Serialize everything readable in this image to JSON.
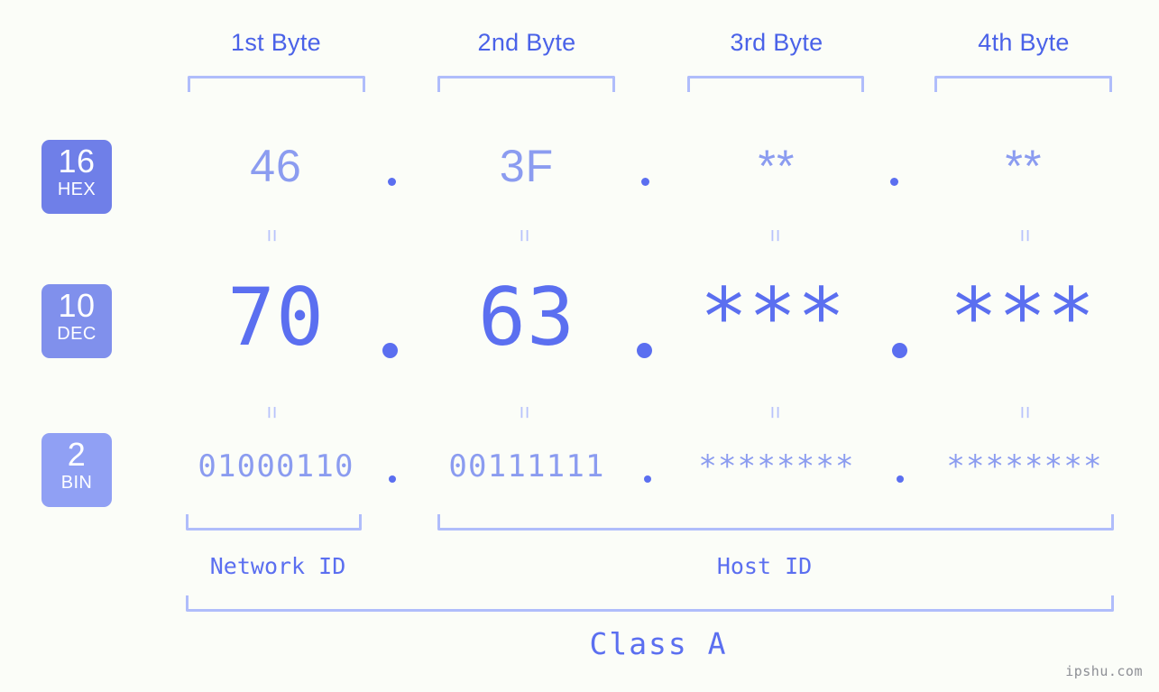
{
  "header": {
    "byte_labels": [
      "1st Byte",
      "2nd Byte",
      "3rd Byte",
      "4th Byte"
    ]
  },
  "bases": [
    {
      "num": "16",
      "name": "HEX",
      "color": "#6f7fe8"
    },
    {
      "num": "10",
      "name": "DEC",
      "color": "#8090ec"
    },
    {
      "num": "2",
      "name": "BIN",
      "color": "#90a0f4"
    }
  ],
  "rows": {
    "hex": {
      "values": [
        "46",
        "3F",
        "**",
        "**"
      ],
      "separators": [
        ".",
        ".",
        "."
      ]
    },
    "dec": {
      "values": [
        "70",
        "63",
        "***",
        "***"
      ],
      "separators": [
        ".",
        ".",
        "."
      ]
    },
    "bin": {
      "values": [
        "01000110",
        "00111111",
        "********",
        "********"
      ],
      "separators": [
        ".",
        ".",
        "."
      ]
    }
  },
  "equals": {
    "symbol": "=",
    "row1": [
      "=",
      "=",
      "=",
      "="
    ],
    "row2": [
      "=",
      "=",
      "=",
      "="
    ]
  },
  "segments": {
    "network_id": "Network ID",
    "host_id": "Host ID",
    "class": "Class A"
  },
  "watermark": "ipshu.com",
  "colors": {
    "background": "#fbfdf8",
    "bracket": "#b0bdfb",
    "header_text": "#4a62e8",
    "hex_text": "#8b9cf0",
    "dec_text": "#5b6ff0",
    "bin_text": "#8b9cf0",
    "badge_text": "#ffffff",
    "equals": "#b8c3fb",
    "watermark": "#8d8f95"
  }
}
